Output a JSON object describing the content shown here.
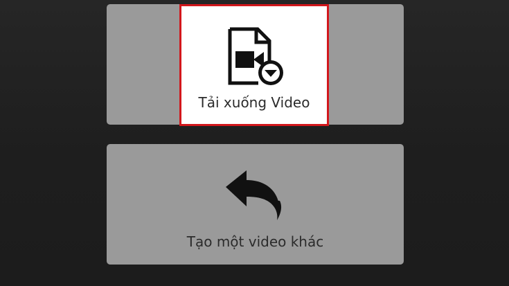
{
  "actions": {
    "download_label": "Tải xuống Video",
    "create_another_label": "Tạo một video khác"
  },
  "icons": {
    "download": "video-file-download-icon",
    "back": "back-arrow-icon"
  },
  "colors": {
    "background": "#222222",
    "panel": "#9a9a9a",
    "highlight_border": "#d2171c",
    "selected_fill": "#ffffff",
    "icon": "#111111"
  }
}
